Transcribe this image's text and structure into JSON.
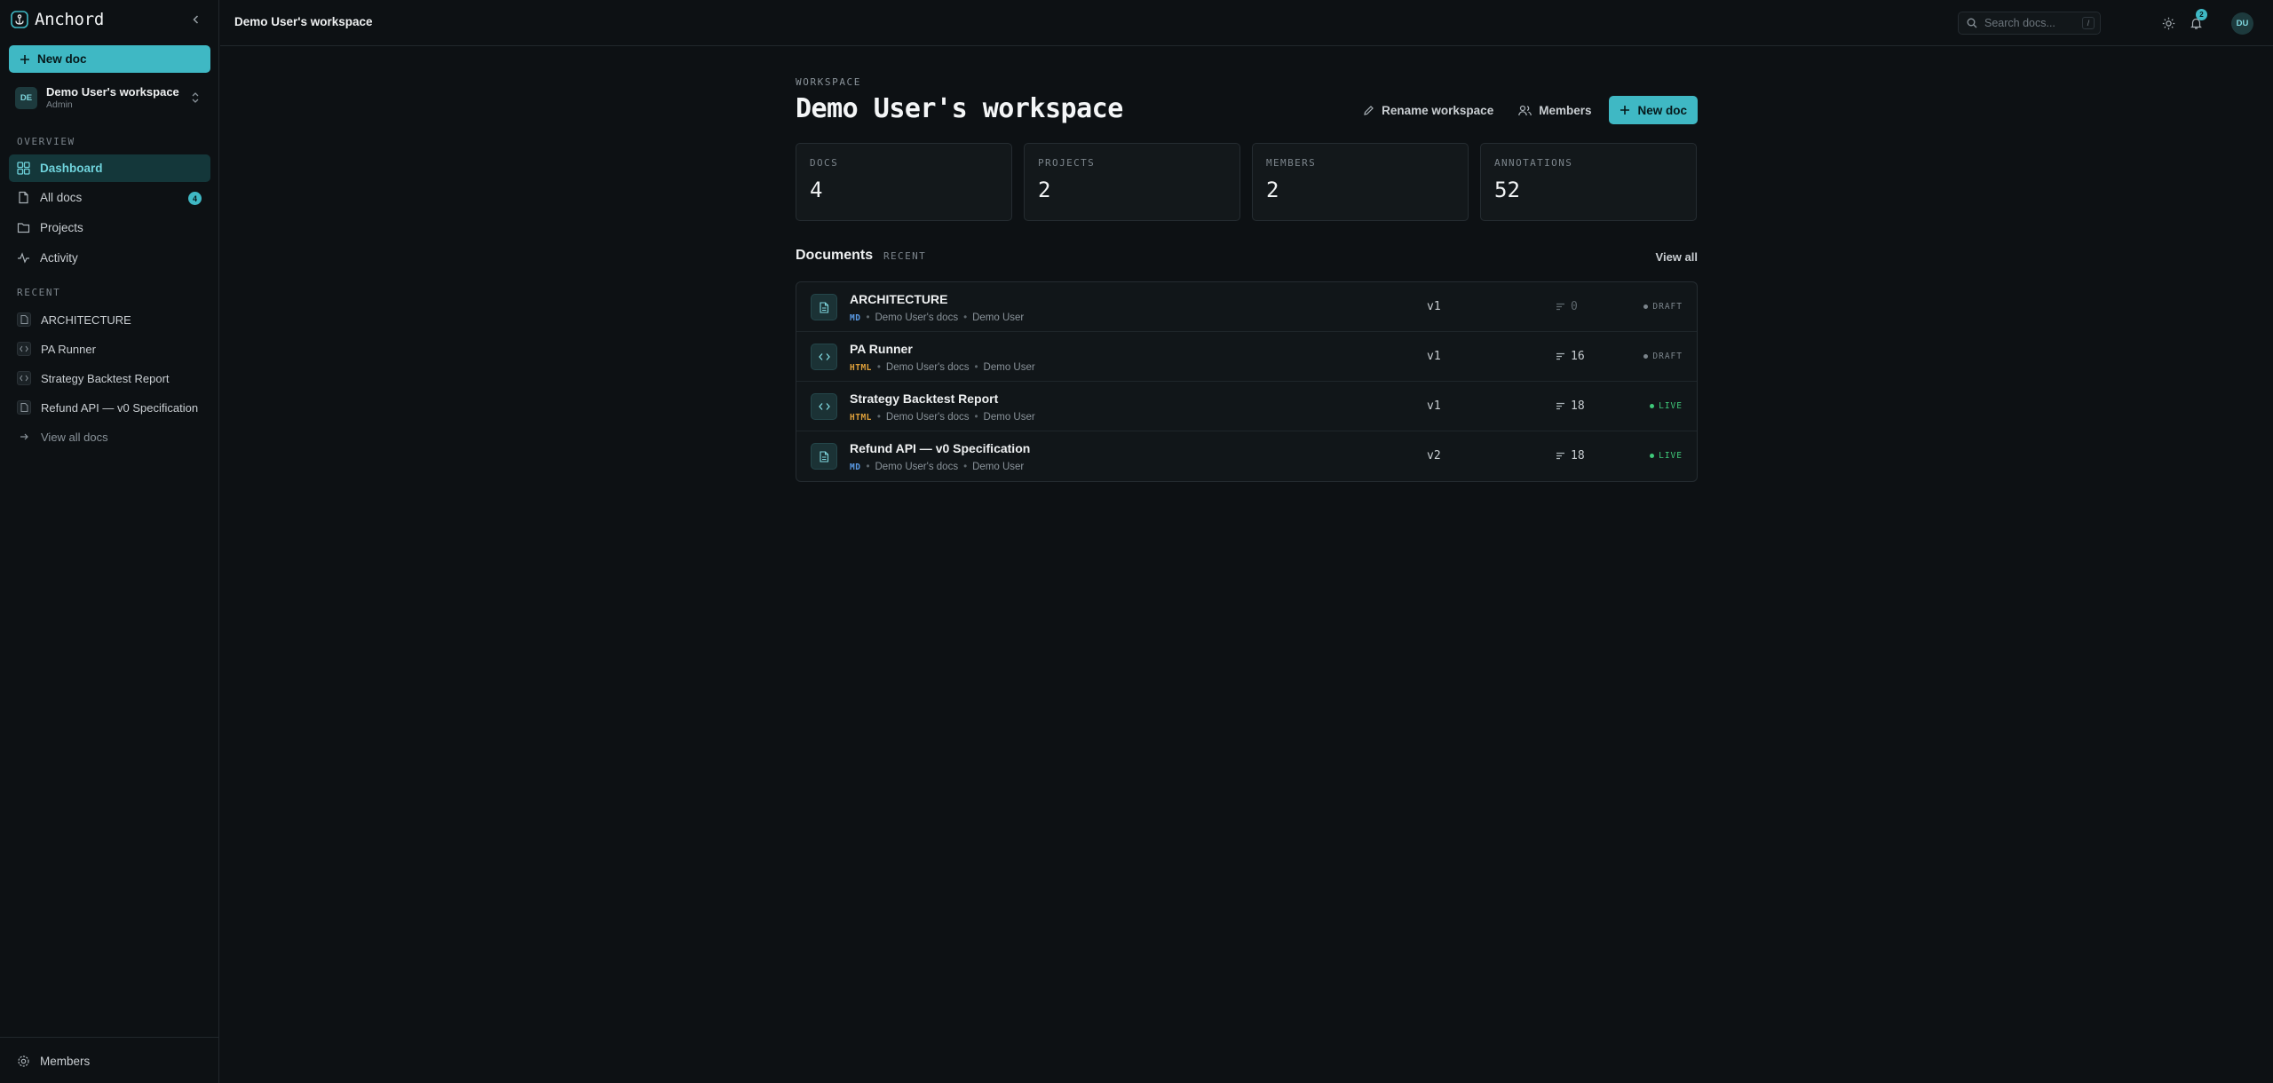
{
  "app": {
    "name": "Anchord"
  },
  "colors": {
    "accent": "#3fb8c4",
    "live": "#3fc97a",
    "draft": "#7b848b",
    "md": "#5b9be6",
    "html": "#e0a13a"
  },
  "sidebar": {
    "new_doc_label": "New doc",
    "workspace": {
      "initials": "DE",
      "name": "Demo User's workspace",
      "role": "Admin"
    },
    "overview_heading": "OVERVIEW",
    "nav": [
      {
        "label": "Dashboard",
        "icon": "grid-icon",
        "active": true
      },
      {
        "label": "All docs",
        "icon": "file-icon",
        "count": "4"
      },
      {
        "label": "Projects",
        "icon": "folder-icon"
      },
      {
        "label": "Activity",
        "icon": "activity-icon"
      }
    ],
    "recent_heading": "RECENT",
    "recent": [
      {
        "label": "ARCHITECTURE",
        "icon": "file-icon"
      },
      {
        "label": "PA Runner",
        "icon": "code-icon"
      },
      {
        "label": "Strategy Backtest Report",
        "icon": "code-icon"
      },
      {
        "label": "Refund API — v0 Specification",
        "icon": "file-icon"
      }
    ],
    "view_all_label": "View all docs",
    "footer_members_label": "Members"
  },
  "topbar": {
    "title": "Demo User's workspace",
    "search_placeholder": "Search docs...",
    "search_shortcut": "/",
    "notification_count": "2",
    "user_initials": "DU"
  },
  "main": {
    "eyebrow": "WORKSPACE",
    "title": "Demo User's workspace",
    "rename_label": "Rename workspace",
    "members_label": "Members",
    "new_doc_label": "New doc",
    "stats": [
      {
        "label": "DOCS",
        "value": "4"
      },
      {
        "label": "PROJECTS",
        "value": "2"
      },
      {
        "label": "MEMBERS",
        "value": "2"
      },
      {
        "label": "ANNOTATIONS",
        "value": "52"
      }
    ],
    "documents_title": "Documents",
    "documents_sub": "RECENT",
    "view_all_label": "View all",
    "documents": [
      {
        "name": "ARCHITECTURE",
        "format": "MD",
        "collection": "Demo User's docs",
        "author": "Demo User",
        "version": "v1",
        "annotations": "0",
        "status": "DRAFT",
        "icon": "file-icon"
      },
      {
        "name": "PA Runner",
        "format": "HTML",
        "collection": "Demo User's docs",
        "author": "Demo User",
        "version": "v1",
        "annotations": "16",
        "status": "DRAFT",
        "icon": "code-icon"
      },
      {
        "name": "Strategy Backtest Report",
        "format": "HTML",
        "collection": "Demo User's docs",
        "author": "Demo User",
        "version": "v1",
        "annotations": "18",
        "status": "LIVE",
        "icon": "code-icon"
      },
      {
        "name": "Refund API — v0 Specification",
        "format": "MD",
        "collection": "Demo User's docs",
        "author": "Demo User",
        "version": "v2",
        "annotations": "18",
        "status": "LIVE",
        "icon": "file-icon"
      }
    ]
  }
}
